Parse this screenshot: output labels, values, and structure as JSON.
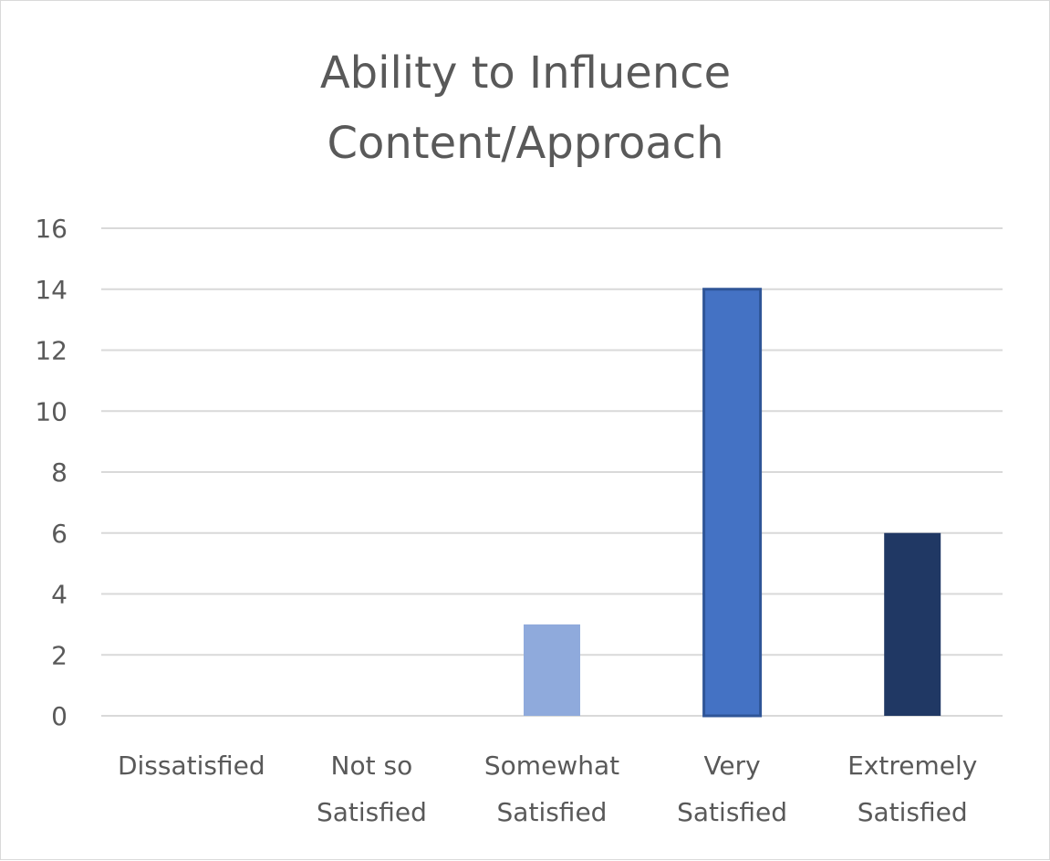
{
  "chart_data": {
    "type": "bar",
    "title": [
      "Ability to Influence",
      "Content/Approach"
    ],
    "categories": [
      [
        "Dissatisfied"
      ],
      [
        "Not so",
        "Satisfied"
      ],
      [
        "Somewhat",
        "Satisfied"
      ],
      [
        "Very",
        "Satisfied"
      ],
      [
        "Extremely",
        "Satisfied"
      ]
    ],
    "values": [
      0,
      0,
      3,
      14,
      6
    ],
    "colors": [
      "#8FAADC",
      "#8FAADC",
      "#8FAADC",
      "#4472C4",
      "#203864"
    ],
    "stroke_colors": [
      "none",
      "none",
      "none",
      "#2F5597",
      "none"
    ],
    "xlabel": "",
    "ylabel": "",
    "ylim": [
      0,
      16
    ],
    "yticks": [
      0,
      2,
      4,
      6,
      8,
      10,
      12,
      14,
      16
    ],
    "grid": true,
    "gridline_color": "#d9d9d9",
    "legend": "none"
  }
}
